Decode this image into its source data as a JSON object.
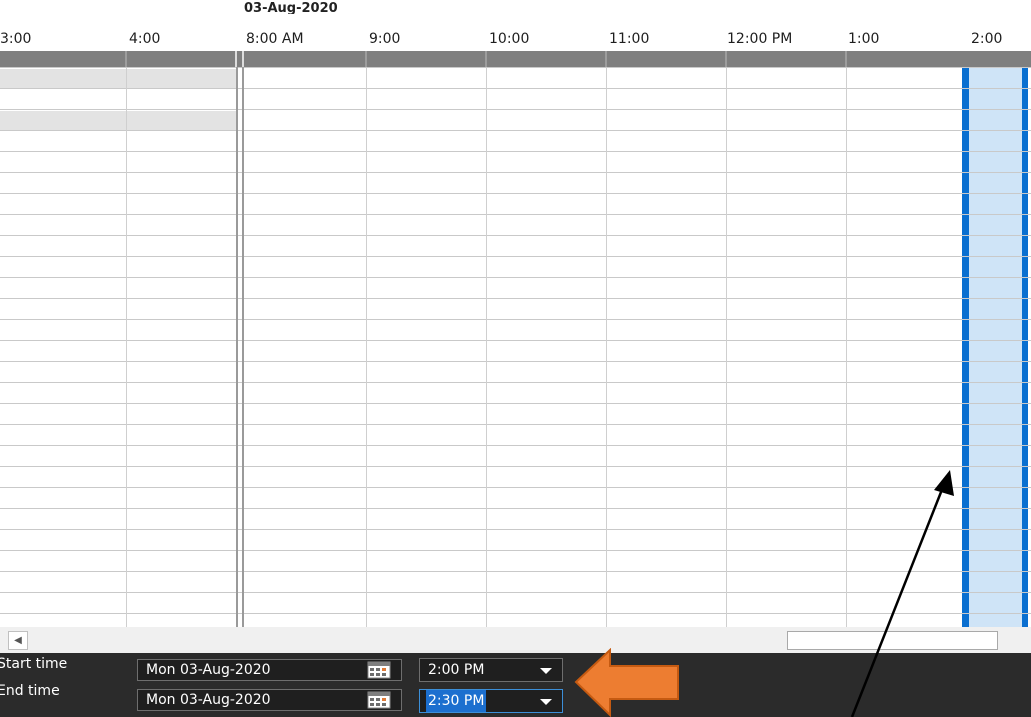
{
  "header": {
    "date": "03-Aug-2020",
    "time_slots": [
      "3:00",
      "4:00",
      "8:00 AM",
      "9:00",
      "10:00",
      "11:00",
      "12:00 PM",
      "1:00",
      "2:00"
    ]
  },
  "selection": {
    "highlight_color": "#cfe4f7",
    "border_color": "#0078d4"
  },
  "form": {
    "start_label": "Start time",
    "end_label": "End time",
    "start_date": "Mon 03-Aug-2020",
    "end_date": "Mon 03-Aug-2020",
    "start_time": "2:00 PM",
    "end_time": "2:30 PM"
  },
  "icons": {
    "calendar": "calendar-icon",
    "dropdown": "chevron-down-icon",
    "scroll_left": "scroll-left-arrow-icon"
  },
  "colors": {
    "annotation_arrow": "#ed7d31",
    "panel_bg": "#2b2b2b",
    "header_bar": "#7f7f7f"
  }
}
